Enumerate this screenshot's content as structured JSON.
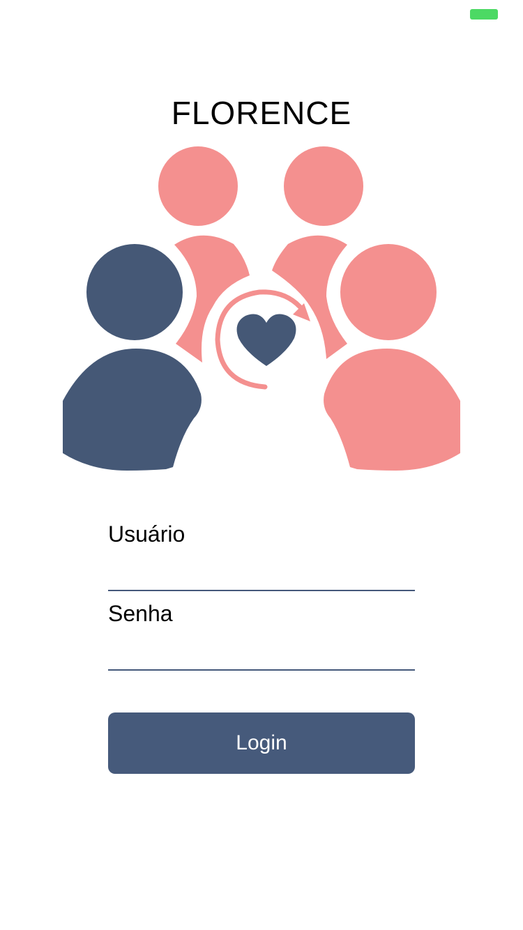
{
  "app": {
    "title": "FLORENCE"
  },
  "status_bar": {
    "battery_icon": "battery-icon"
  },
  "logo": {
    "icon": "family-care-heart-logo",
    "colors": {
      "navy": "#455876",
      "pink": "#f4908f"
    }
  },
  "form": {
    "username": {
      "label": "Usuário",
      "value": "",
      "placeholder": ""
    },
    "password": {
      "label": "Senha",
      "value": "",
      "placeholder": ""
    },
    "login_label": "Login"
  },
  "colors": {
    "accent": "#465a7b",
    "battery": "#4cd964",
    "divider": "#44587a",
    "background": "#ffffff"
  }
}
